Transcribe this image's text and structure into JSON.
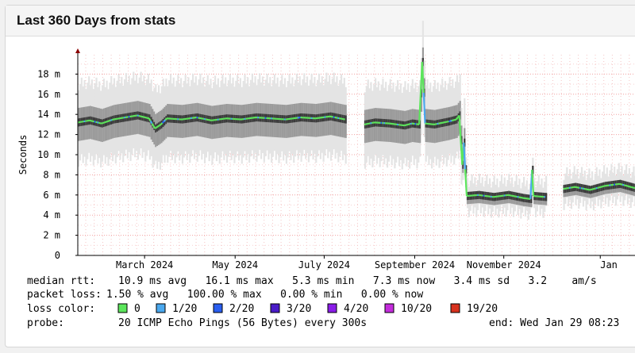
{
  "panel": {
    "title": "Last 360 Days from stats"
  },
  "chart_data": {
    "type": "line",
    "ylabel": "Seconds",
    "y_ticks": [
      "0",
      "2 m",
      "4 m",
      "6 m",
      "8 m",
      "10 m",
      "12 m",
      "14 m",
      "16 m",
      "18 m"
    ],
    "ylim_ms": [
      0,
      20
    ],
    "x_ticks": [
      "March 2024",
      "May 2024",
      "July 2024",
      "September 2024",
      "November 2024",
      "Jan"
    ],
    "grid": true,
    "series": [
      {
        "name": "median rtt",
        "segments": [
          [
            [
              0,
              13.2
            ],
            [
              8,
              13.4
            ],
            [
              16,
              13.1
            ],
            [
              24,
              13.5
            ],
            [
              32,
              13.7
            ],
            [
              40,
              13.9
            ],
            [
              48,
              13.6
            ],
            [
              52,
              12.6
            ],
            [
              56,
              13.0
            ],
            [
              60,
              13.6
            ],
            [
              70,
              13.5
            ],
            [
              80,
              13.7
            ],
            [
              90,
              13.4
            ],
            [
              100,
              13.6
            ],
            [
              110,
              13.5
            ],
            [
              120,
              13.7
            ],
            [
              130,
              13.6
            ],
            [
              140,
              13.5
            ],
            [
              150,
              13.7
            ],
            [
              160,
              13.6
            ],
            [
              170,
              13.8
            ],
            [
              180,
              13.5
            ]
          ],
          [
            [
              193,
              13.0
            ],
            [
              200,
              13.2
            ],
            [
              210,
              13.1
            ],
            [
              220,
              12.9
            ],
            [
              225,
              13.1
            ],
            [
              230,
              13.0
            ],
            [
              232,
              19.2
            ],
            [
              234,
              13.1
            ],
            [
              240,
              13.0
            ],
            [
              250,
              13.3
            ],
            [
              255,
              13.5
            ],
            [
              257,
              13.9
            ],
            [
              259,
              9.0
            ],
            [
              260,
              11.2
            ],
            [
              262,
              5.9
            ],
            [
              270,
              6.0
            ],
            [
              280,
              5.8
            ],
            [
              290,
              6.0
            ],
            [
              300,
              5.7
            ],
            [
              305,
              5.6
            ],
            [
              306,
              8.5
            ],
            [
              307,
              5.9
            ],
            [
              315,
              5.8
            ]
          ],
          [
            [
              327,
              6.6
            ],
            [
              335,
              6.8
            ],
            [
              345,
              6.5
            ],
            [
              355,
              6.9
            ],
            [
              365,
              7.1
            ],
            [
              375,
              6.7
            ],
            [
              385,
              6.6
            ],
            [
              395,
              6.8
            ],
            [
              405,
              6.9
            ],
            [
              410,
              7.2
            ],
            [
              412,
              9.0
            ],
            [
              414,
              7.3
            ],
            [
              420,
              7.2
            ],
            [
              425,
              6.9
            ],
            [
              427,
              9.8
            ],
            [
              429,
              7.1
            ]
          ]
        ]
      }
    ]
  },
  "stats": [
    {
      "label": "median rtt:",
      "text": "10.9 ms avg   16.1 ms max   5.3 ms min   7.3 ms now   3.4 ms sd   3.2    am/s"
    },
    {
      "label": "packet loss:",
      "text": "1.50 % avg   100.00 % max   0.00 % min   0.00 % now"
    }
  ],
  "loss_color": {
    "label": "loss color:",
    "items": [
      {
        "color": "#5ce65c",
        "label": "0"
      },
      {
        "color": "#4aa8ee",
        "label": "1/20"
      },
      {
        "color": "#2a5ef0",
        "label": "2/20"
      },
      {
        "color": "#4a1cc8",
        "label": "3/20"
      },
      {
        "color": "#8a1ce8",
        "label": "4/20"
      },
      {
        "color": "#c42cdc",
        "label": "10/20"
      },
      {
        "color": "#d8321e",
        "label": "19/20"
      }
    ]
  },
  "probe": {
    "label": "probe:",
    "text": "20 ICMP Echo Pings (56 Bytes) every 300s",
    "end": "end: Wed Jan 29 08:23"
  }
}
